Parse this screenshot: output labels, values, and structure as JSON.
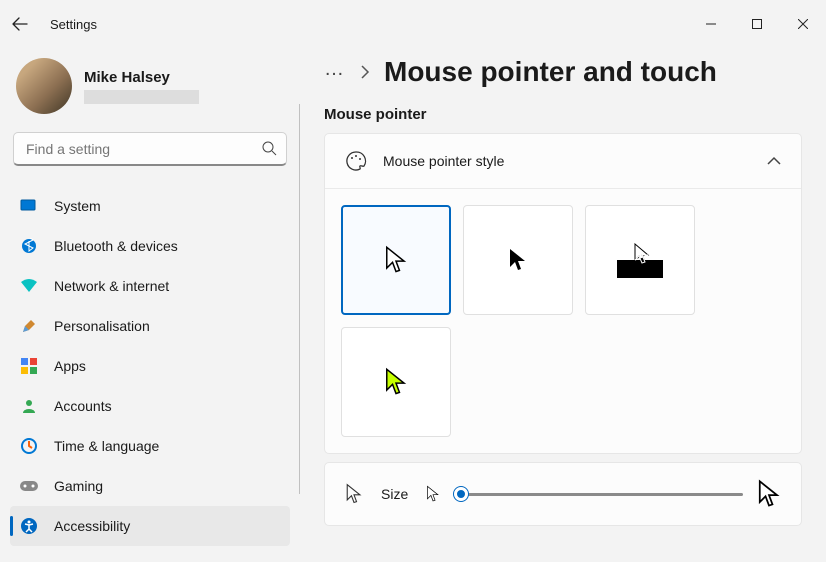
{
  "window": {
    "title": "Settings"
  },
  "user": {
    "name": "Mike Halsey"
  },
  "search": {
    "placeholder": "Find a setting"
  },
  "nav": {
    "items": [
      {
        "label": "System"
      },
      {
        "label": "Bluetooth & devices"
      },
      {
        "label": "Network & internet"
      },
      {
        "label": "Personalisation"
      },
      {
        "label": "Apps"
      },
      {
        "label": "Accounts"
      },
      {
        "label": "Time & language"
      },
      {
        "label": "Gaming"
      },
      {
        "label": "Accessibility"
      }
    ]
  },
  "breadcrumb": {
    "dots": "…",
    "title": "Mouse pointer and touch"
  },
  "section": {
    "label": "Mouse pointer"
  },
  "style_card": {
    "title": "Mouse pointer style"
  },
  "size_card": {
    "title": "Size",
    "value": 1,
    "min": 1,
    "max": 15
  }
}
